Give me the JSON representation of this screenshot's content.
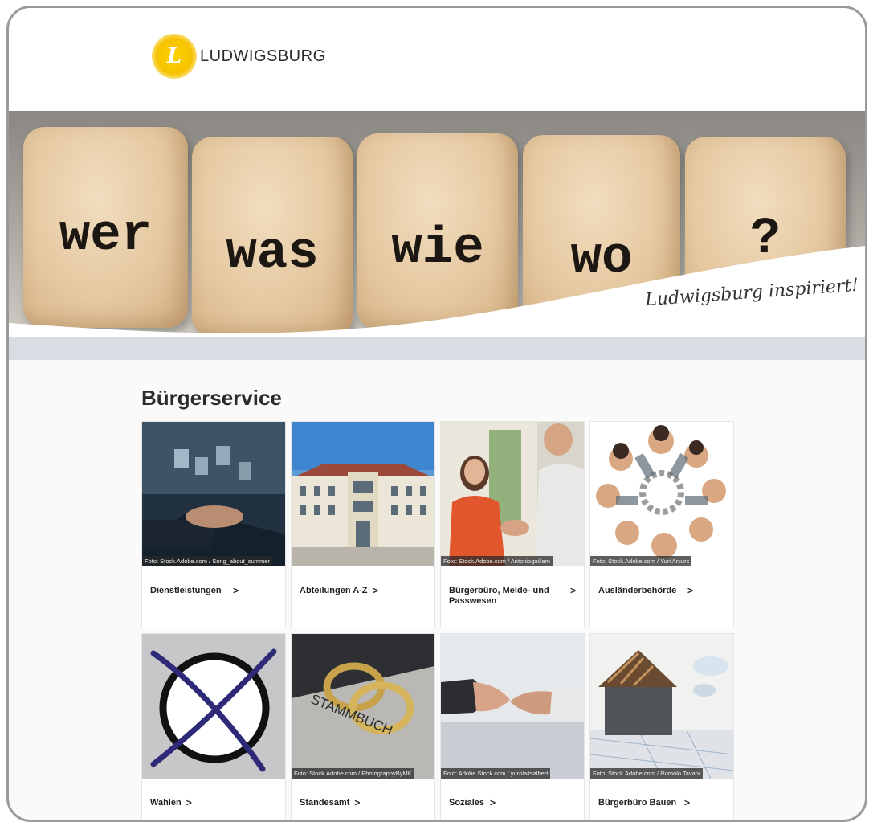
{
  "header": {
    "logo_glyph": "L",
    "logo_text": "LUDWIGSBURG",
    "accent": "#f6c200"
  },
  "hero": {
    "words": [
      "wer",
      "was",
      "wie",
      "wo",
      "?"
    ],
    "tagline": "Ludwigsburg inspiriert!"
  },
  "main": {
    "title": "Bürgerservice",
    "cards": [
      {
        "label": "Dienstleistungen",
        "credit": "Foto: Stock.Adobe.com / Song_about_summer",
        "chevron": ">",
        "icon": "laptop-documents-photo"
      },
      {
        "label": "Abteilungen A-Z",
        "credit": "",
        "chevron": ">",
        "icon": "town-hall-photo"
      },
      {
        "label": "Bürgerbüro, Melde- und Passwesen",
        "credit": "Foto: Stock.Adobe.com / Antonioguillem",
        "chevron": ">",
        "icon": "handshake-photo"
      },
      {
        "label": "Ausländerbehörde",
        "credit": "Foto: Stock.Adobe.com / Yuri Arcurs",
        "chevron": ">",
        "icon": "group-circle-photo"
      },
      {
        "label": "Wahlen",
        "credit": "",
        "chevron": ">",
        "icon": "ballot-cross-icon"
      },
      {
        "label": "Standesamt",
        "credit": "Foto: Stock.Adobe.com / PhotographyByMK",
        "chevron": ">",
        "icon": "wedding-rings-photo"
      },
      {
        "label": "Soziales",
        "credit": "Foto: Adobe.Stock.com / yurolaitsalbert",
        "chevron": ">",
        "icon": "hands-reaching-photo"
      },
      {
        "label": "Bürgerbüro Bauen",
        "credit": "Foto: Stock.Adobe.com / Romolo Tavani",
        "chevron": ">",
        "icon": "house-construction-photo"
      }
    ]
  },
  "stammbuch_text": "STAMMBUCH"
}
